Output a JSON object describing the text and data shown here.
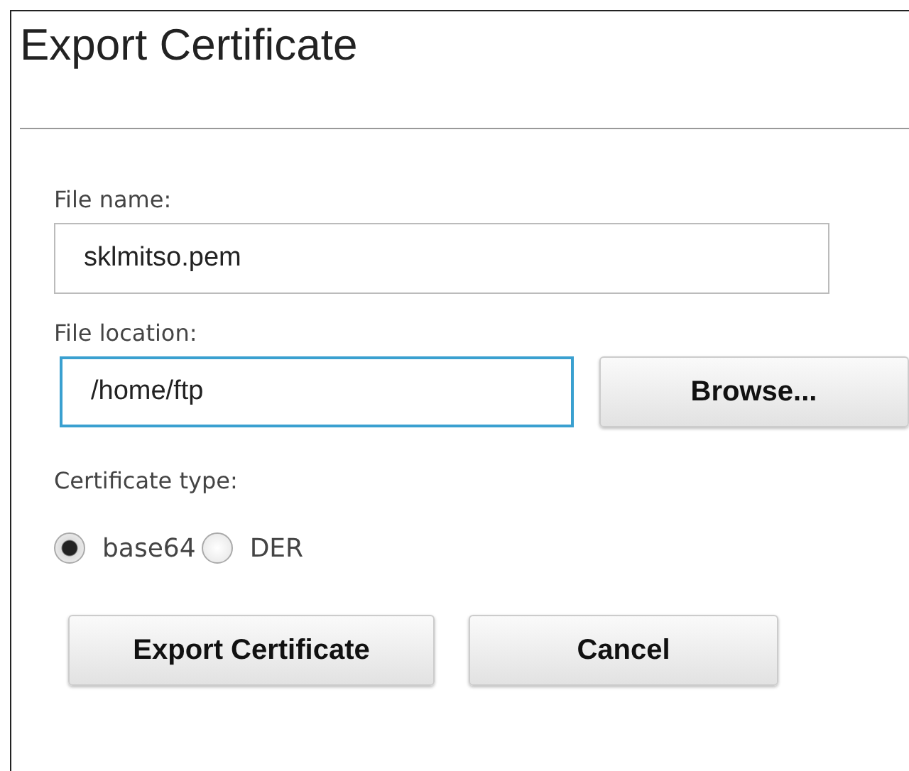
{
  "title": "Export Certificate",
  "fields": [
    {
      "label": "File name:",
      "value": "sklmitso.pem",
      "focused": false
    },
    {
      "label": "File location:",
      "value": "/home/ftp",
      "focused": true,
      "button": "Browse..."
    }
  ],
  "certificate_type": {
    "label": "Certificate type:",
    "options": [
      {
        "label": "base64",
        "selected": true
      },
      {
        "label": "DER",
        "selected": false
      }
    ]
  },
  "buttons": [
    "Export Certificate",
    "Cancel"
  ]
}
